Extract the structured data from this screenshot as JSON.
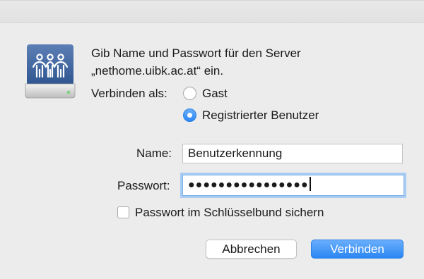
{
  "dialog": {
    "message_line1": "Gib Name und Passwort für den Server",
    "message_line2": "„nethome.uibk.ac.at“ ein.",
    "icon": "network-server-icon"
  },
  "connect_as": {
    "label": "Verbinden als:",
    "options": [
      {
        "label": "Gast",
        "selected": false
      },
      {
        "label": "Registrierter Benutzer",
        "selected": true
      }
    ]
  },
  "form": {
    "name_label": "Name:",
    "name_value": "Benutzerkennung",
    "password_label": "Passwort:",
    "password_value": "●●●●●●●●●●●●●●●●",
    "keychain_label": "Passwort im Schlüsselbund sichern",
    "keychain_checked": false
  },
  "buttons": {
    "cancel": "Abbrechen",
    "connect": "Verbinden"
  },
  "colors": {
    "accent": "#2b86f3",
    "background": "#ececec"
  }
}
